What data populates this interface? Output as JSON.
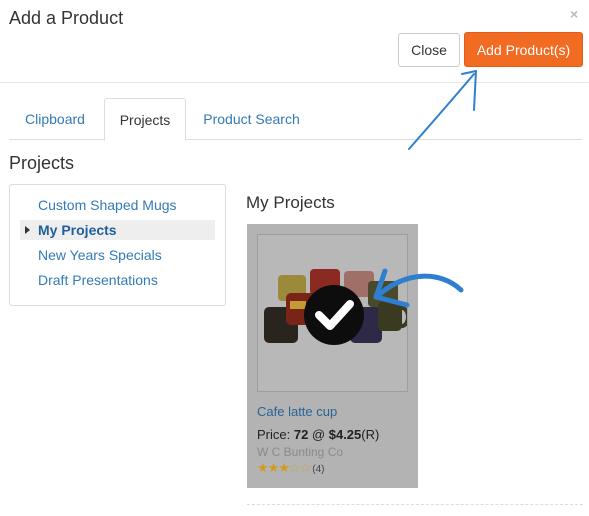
{
  "modal": {
    "title": "Add a Product",
    "close_glyph": "×"
  },
  "buttons": {
    "close_label": "Close",
    "add_label": "Add Product(s)"
  },
  "tabs": [
    {
      "label": "Clipboard",
      "active": false
    },
    {
      "label": "Projects",
      "active": true
    },
    {
      "label": "Product Search",
      "active": false
    }
  ],
  "projects_section": {
    "title": "Projects",
    "items": [
      {
        "label": "Custom Shaped Mugs",
        "active": false
      },
      {
        "label": "My Projects",
        "active": true
      },
      {
        "label": "New Years Specials",
        "active": false
      },
      {
        "label": "Draft Presentations",
        "active": false
      }
    ]
  },
  "my_projects": {
    "title": "My Projects",
    "product": {
      "name": "Cafe latte cup",
      "price_prefix": "Price: ",
      "quantity": "72",
      "at": " @ ",
      "price": "$4.25",
      "price_code": "(R)",
      "supplier": "W C Bunting Co",
      "rating": 3,
      "rating_max": 5,
      "rating_count": "(4)",
      "selected": true
    }
  },
  "colors": {
    "accent_orange": "#f26b22",
    "link_blue": "#337ab7",
    "annotation_blue": "#2f7fd0",
    "star_gold": "#d59a1c"
  },
  "icons": [
    "close-icon",
    "checkmark-icon",
    "caret-right-icon",
    "star-icon",
    "annotation-arrow-icon"
  ]
}
